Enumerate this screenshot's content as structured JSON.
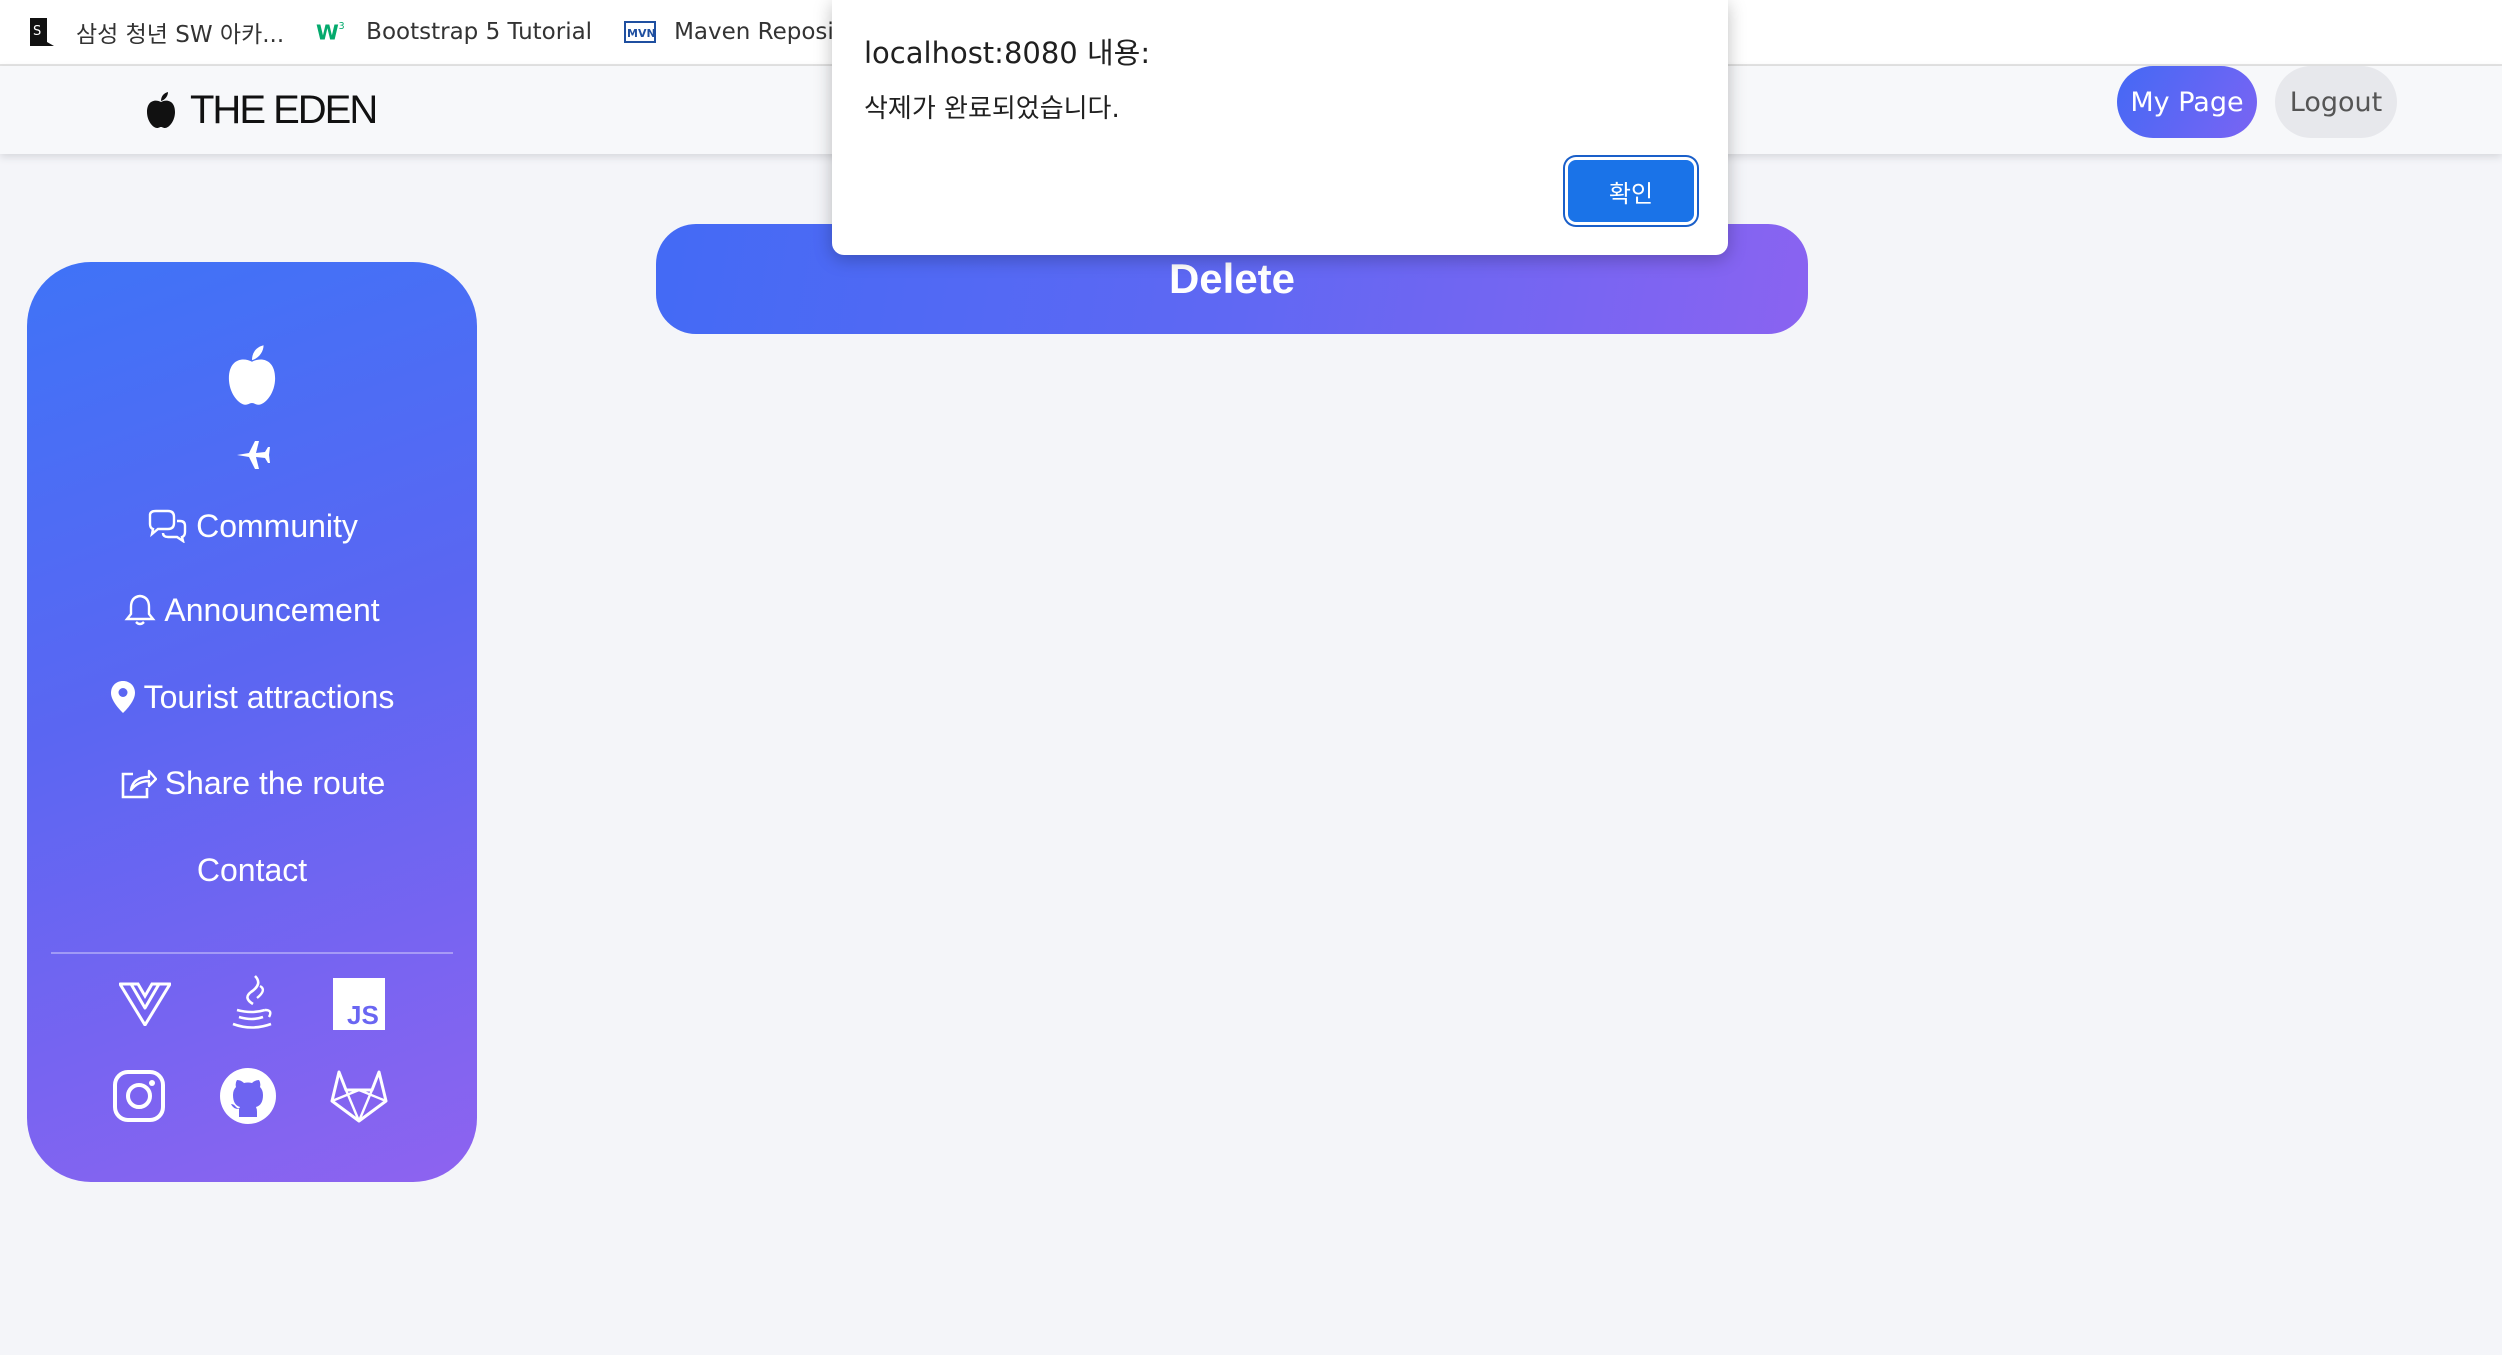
{
  "bookmarks": [
    {
      "label": "삼성 청년 SW 아카...",
      "icon": "ssafy-icon"
    },
    {
      "label": "Bootstrap 5 Tutorial",
      "icon": "w3schools-icon"
    },
    {
      "label": "Maven Reposit",
      "icon": "maven-icon"
    }
  ],
  "header": {
    "logo_text": "THE EDEN",
    "mypage_label": "My Page",
    "logout_label": "Logout"
  },
  "sidebar": {
    "nav": [
      {
        "label": "Community",
        "icon": "chat-dots-icon"
      },
      {
        "label": "Announcement",
        "icon": "bell-icon"
      },
      {
        "label": "Tourist attractions",
        "icon": "map-pin-icon"
      },
      {
        "label": "Share the route",
        "icon": "share-icon"
      },
      {
        "label": "Contact",
        "icon": ""
      }
    ],
    "tech_icons": [
      "vue-icon",
      "java-icon",
      "javascript-icon"
    ],
    "social_icons": [
      "instagram-icon",
      "github-icon",
      "gitlab-icon"
    ],
    "js_badge_text": "JS"
  },
  "main": {
    "banner_title": "Delete"
  },
  "dialog": {
    "title": "localhost:8080 내용:",
    "message": "삭제가 완료되었습니다.",
    "ok_label": "확인"
  },
  "colors": {
    "accent_start": "#3f73f7",
    "accent_end": "#8e63f0",
    "dialog_button": "#1a73e8"
  }
}
